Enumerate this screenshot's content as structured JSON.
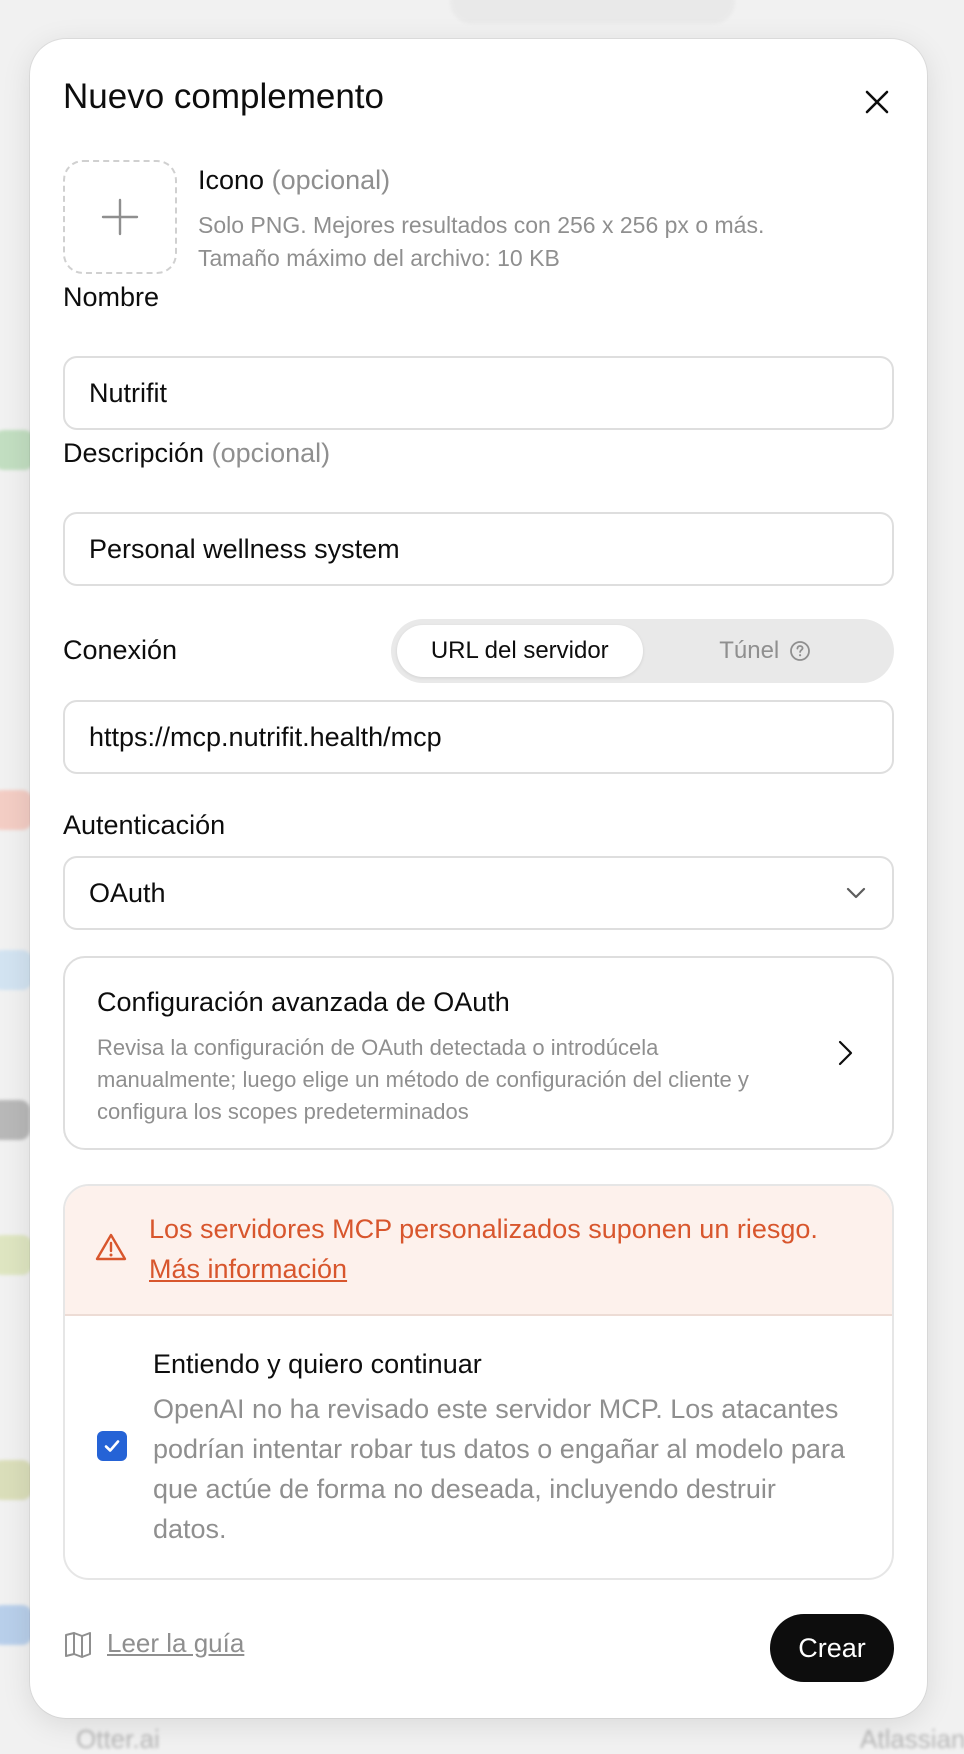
{
  "modal": {
    "title": "Nuevo complemento",
    "icon_label": "Icono",
    "optional_tag": "(opcional)",
    "icon_hint_line1": "Solo PNG. Mejores resultados con 256 x 256 px o más.",
    "icon_hint_line2": "Tamaño máximo del archivo: 10 KB",
    "name_label": "Nombre",
    "name_value": "Nutrifit",
    "description_label": "Descripción",
    "description_value": "Personal wellness system",
    "connection_label": "Conexión",
    "connection_options": {
      "server_url": "URL del servidor",
      "tunnel": "Túnel"
    },
    "connection_selected": "URL del servidor",
    "server_url_value": "https://mcp.nutrifit.health/mcp",
    "auth_label": "Autenticación",
    "auth_value": "OAuth",
    "advanced_title": "Configuración avanzada de OAuth",
    "advanced_description": "Revisa la configuración de OAuth detectada o introdúcela manualmente; luego elige un método de configuración del cliente y configura los scopes predeterminados",
    "warning_text": "Los servidores MCP personalizados suponen un riesgo.",
    "warning_link": "Más información",
    "ack_title": "Entiendo y quiero continuar",
    "ack_description": "OpenAI no ha revisado este servidor MCP. Los atacantes podrían intentar robar tus datos o engañar al modelo para que actúe de forma no deseada, incluyendo destruir datos.",
    "ack_checked": true,
    "guide_label": "Leer la guía",
    "create_label": "Crear"
  },
  "colors": {
    "warning": "#d8562d",
    "warning_bg": "#fdf1ec",
    "checkbox": "#2563d6",
    "primary_button": "#0d0d0d"
  },
  "background": {
    "bottom_left_label": "Otter.ai",
    "bottom_right_label": "Atlassian"
  }
}
